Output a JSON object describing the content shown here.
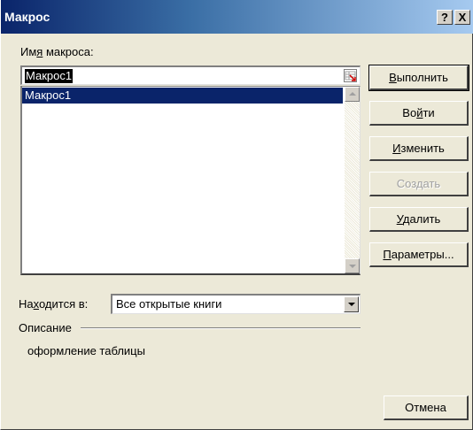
{
  "window": {
    "title": "Макрос",
    "help_btn": "?",
    "close_btn": "X"
  },
  "macro_name": {
    "label_pre": "Им",
    "label_acc": "я",
    "label_post": " макроса:",
    "value": "Макрос1"
  },
  "macro_list": {
    "items": [
      "Макрос1"
    ],
    "selected_index": 0
  },
  "buttons": {
    "run": {
      "pre": "",
      "acc": "В",
      "post": "ыполнить"
    },
    "step_into": {
      "pre": "Во",
      "acc": "й",
      "post": "ти"
    },
    "edit": {
      "pre": "",
      "acc": "И",
      "post": "зменить"
    },
    "create": {
      "label": "Создать",
      "disabled": true
    },
    "delete": {
      "pre": "",
      "acc": "У",
      "post": "далить"
    },
    "options": {
      "pre": "",
      "acc": "П",
      "post": "араметры..."
    },
    "cancel": {
      "label": "Отмена"
    }
  },
  "location": {
    "label_pre": "На",
    "label_acc": "х",
    "label_post": "одится в:",
    "value": "Все открытые книги"
  },
  "description": {
    "label": "Описание",
    "text": "оформление таблицы"
  },
  "colors": {
    "title_start": "#0a246a",
    "title_end": "#a6caf0",
    "selection": "#0a246a",
    "dialog_bg": "#ece9d8"
  }
}
